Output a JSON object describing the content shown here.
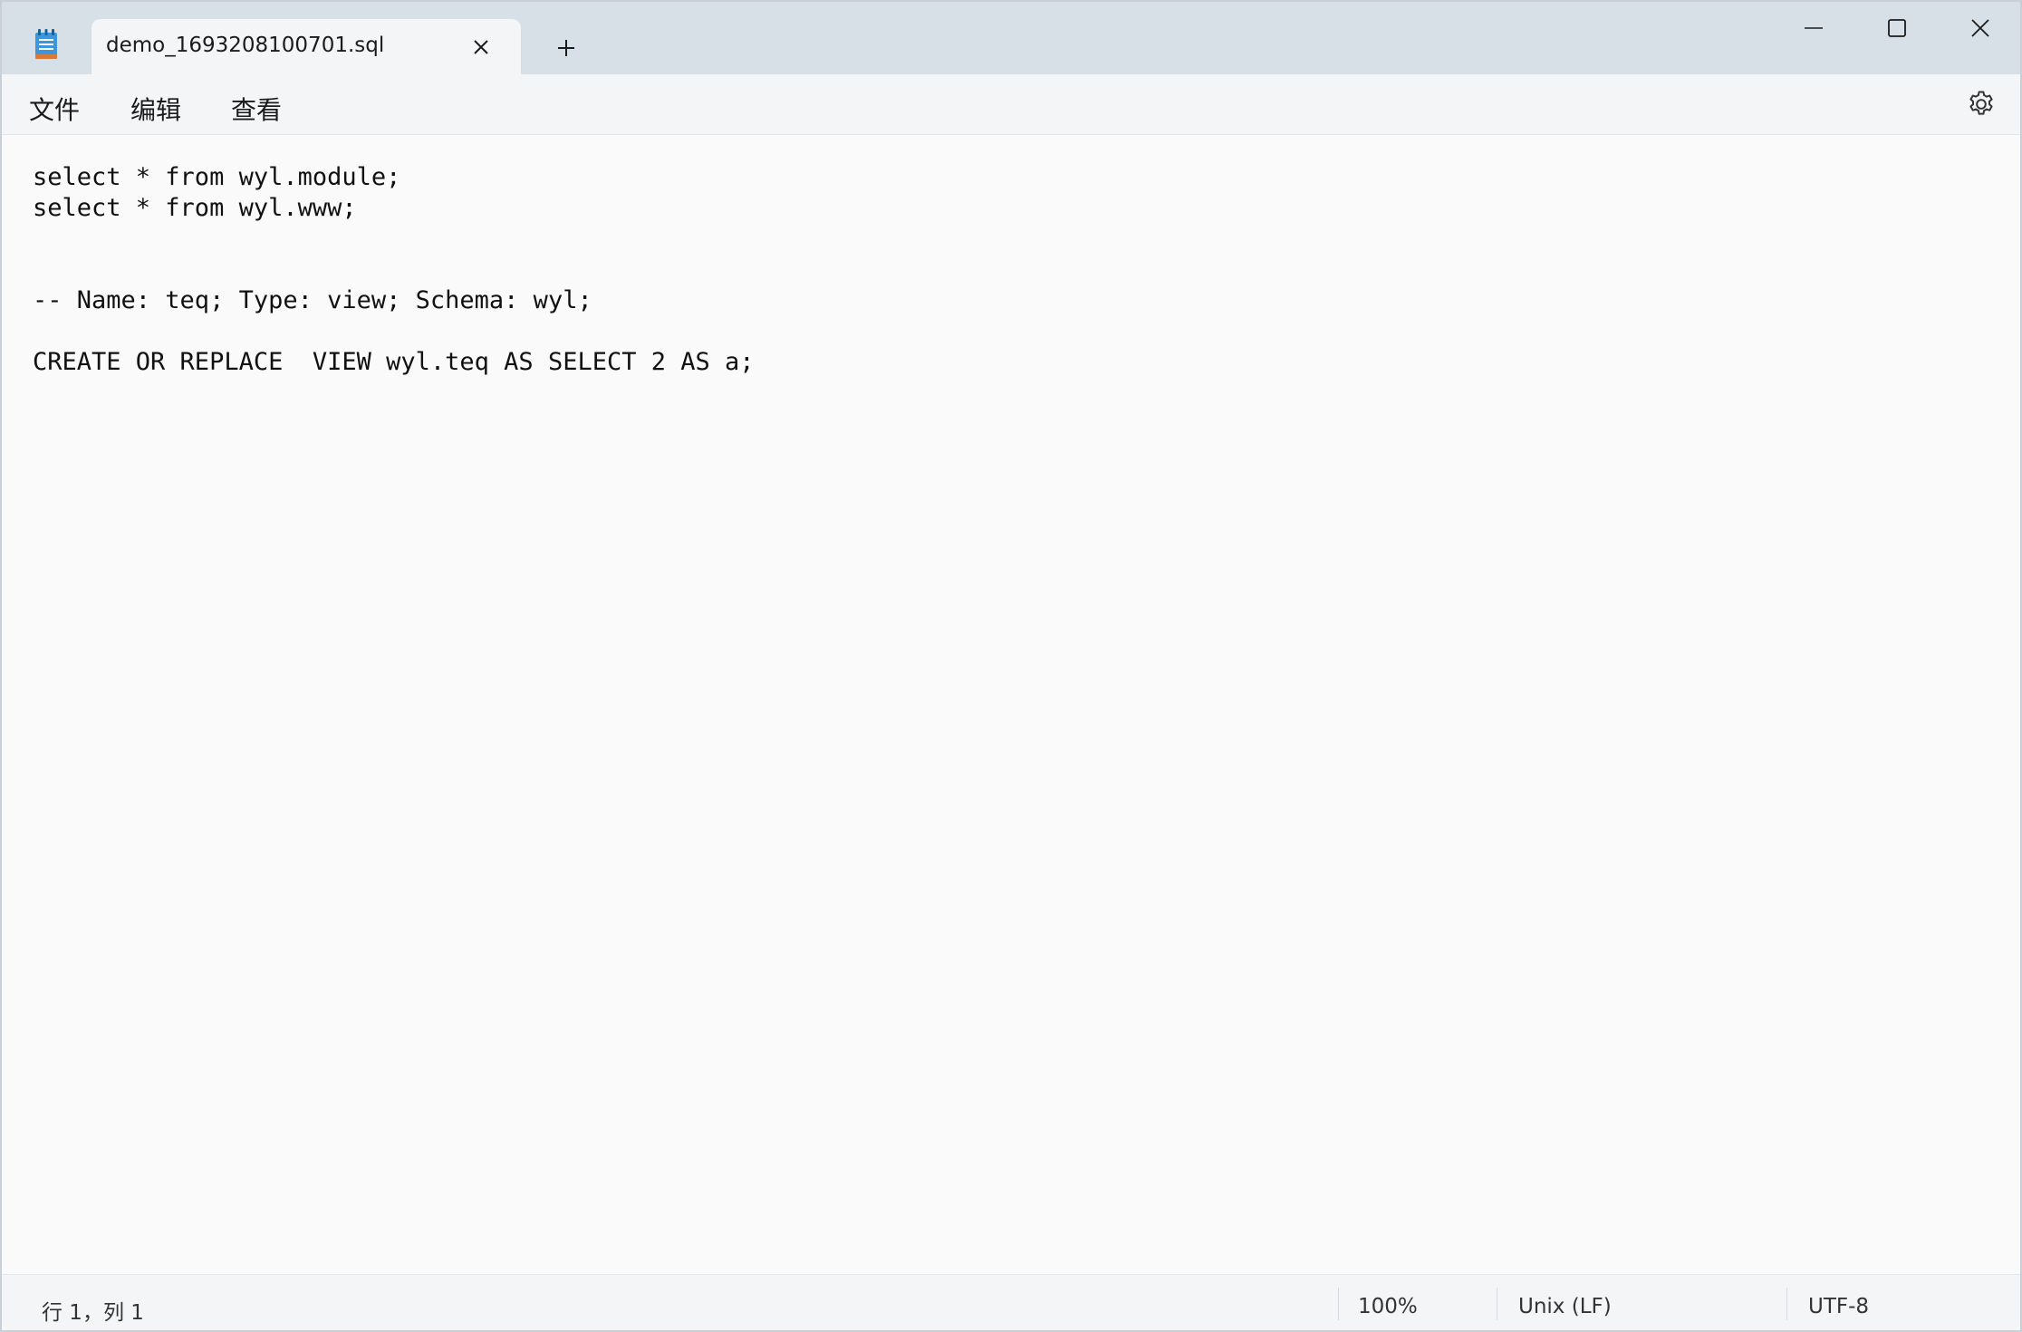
{
  "tab": {
    "title": "demo_1693208100701.sql"
  },
  "menu": {
    "file": "文件",
    "edit": "编辑",
    "view": "查看"
  },
  "editor": {
    "lines": [
      "select * from wyl.module;",
      "select * from wyl.www;",
      "",
      "",
      "-- Name: teq; Type: view; Schema: wyl;",
      "",
      "CREATE OR REPLACE  VIEW wyl.teq AS SELECT 2 AS a;"
    ]
  },
  "status": {
    "position": "行 1，列 1",
    "zoom": "100%",
    "line_ending": "Unix (LF)",
    "encoding": "UTF-8"
  },
  "icons": {
    "app": "notepad-icon",
    "tab_close": "close-icon",
    "new_tab": "plus-icon",
    "minimize": "minimize-icon",
    "maximize": "maximize-icon",
    "close": "close-icon",
    "settings": "gear-icon"
  },
  "colors": {
    "titlebar": "#d8e0e7",
    "tab": "#f3f5f7",
    "editor_bg": "#fafafa",
    "app_icon_accent": "#2b88d8"
  }
}
